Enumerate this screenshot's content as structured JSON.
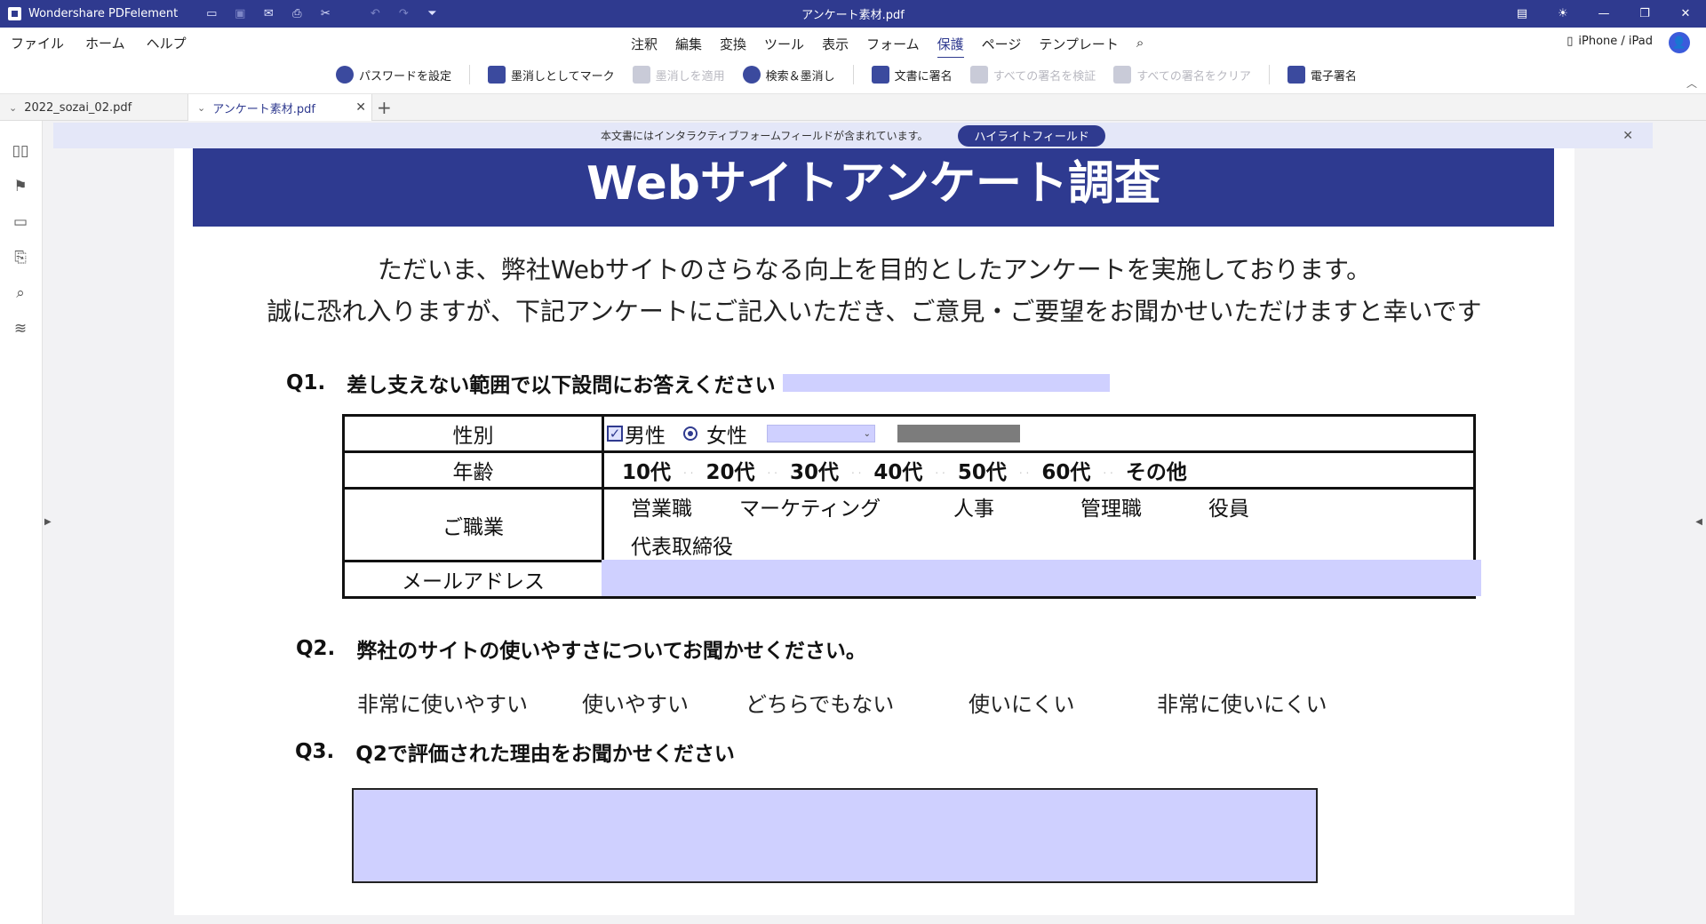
{
  "app": {
    "name": "Wondershare PDFelement",
    "doc_title": "アンケート素材.pdf"
  },
  "menus": {
    "left": [
      "ファイル",
      "ホーム",
      "ヘルプ"
    ],
    "tabs": [
      "注釈",
      "編集",
      "変換",
      "ツール",
      "表示",
      "フォーム",
      "保護",
      "ページ",
      "テンプレート"
    ],
    "active_tab": "保護",
    "device_label": "iPhone / iPad"
  },
  "toolbar": {
    "set_password": "パスワードを設定",
    "mark_redaction": "墨消しとしてマーク",
    "apply_redaction": "墨消しを適用",
    "search_redact": "検索＆墨消し",
    "sign_document": "文書に署名",
    "verify_all": "すべての署名を検証",
    "clear_all": "すべての署名をクリア",
    "electronic_sign": "電子署名"
  },
  "doc_tabs": [
    {
      "label": "2022_sozai_02.pdf"
    },
    {
      "label": "アンケート素材.pdf"
    }
  ],
  "notification": {
    "text": "本文書にはインタラクティブフォームフィールドが含まれています。",
    "button": "ハイライトフィールド"
  },
  "document": {
    "banner": "Webサイトアンケート調査",
    "intro_line1": "ただいま、弊社Webサイトのさらなる向上を目的としたアンケートを実施しております。",
    "intro_line2": "誠に恐れ入りますが、下記アンケートにご記入いただき、ご意見・ご要望をお聞かせいただけますと幸いです",
    "q1": {
      "num": "Q1.",
      "text": "差し支えない範囲で以下設問にお答えください"
    },
    "table": {
      "gender_label": "性別",
      "male": "男性",
      "female": "女性",
      "age_label": "年齢",
      "ages": [
        "10代",
        "20代",
        "30代",
        "40代",
        "50代",
        "60代",
        "その他"
      ],
      "job_label": "ご職業",
      "jobs": [
        "営業職",
        "マーケティング",
        "人事",
        "管理職",
        "役員",
        "代表取締役"
      ],
      "mail_label": "メールアドレス"
    },
    "q2": {
      "num": "Q2.",
      "text": "弊社のサイトの使いやすさについてお聞かせください。"
    },
    "q2_options": [
      "非常に使いやすい",
      "使いやすい",
      "どちらでもない",
      "使いにくい",
      "非常に使いにくい"
    ],
    "q3": {
      "num": "Q3.",
      "text": "Q2で評価された理由をお聞かせください"
    }
  }
}
